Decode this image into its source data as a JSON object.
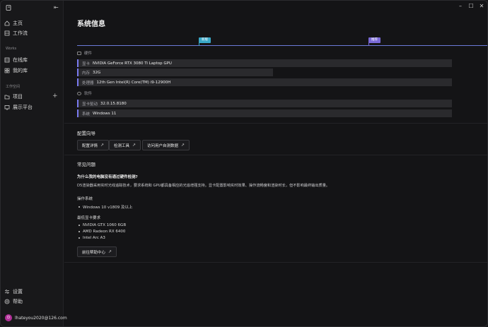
{
  "sidebar": {
    "nav": [
      {
        "label": "主页",
        "icon": "home-icon"
      },
      {
        "label": "工作流",
        "icon": "workflow-icon"
      }
    ],
    "works_label": "Works",
    "works": [
      {
        "label": "在线库",
        "icon": "library-icon"
      },
      {
        "label": "我的库",
        "icon": "my-library-icon"
      }
    ],
    "workspace_label": "工作空间",
    "workspace": [
      {
        "label": "项目",
        "icon": "project-icon"
      },
      {
        "label": "展示平台",
        "icon": "showcase-icon"
      }
    ],
    "bottom": [
      {
        "label": "设置",
        "icon": "settings-icon"
      },
      {
        "label": "帮助",
        "icon": "help-icon"
      }
    ],
    "user": {
      "initial": "D",
      "email": "lhateyou2020@126.com"
    }
  },
  "main": {
    "title": "系统信息",
    "timeline": {
      "tag_left": "新版",
      "tag_right": "推荐"
    },
    "hardware_label": "硬件",
    "hardware": [
      {
        "key": "显卡",
        "value": "NVIDIA GeForce RTX 3080 Ti Laptop GPU"
      },
      {
        "key": "内存",
        "value": "32G"
      },
      {
        "key": "处理器",
        "value": "12th Gen Intel(R) Core(TM) i9-12900H"
      }
    ],
    "software_label": "软件",
    "software": [
      {
        "key": "显卡驱动",
        "value": "32.0.15.8180"
      },
      {
        "key": "系统",
        "value": "Windows 11"
      }
    ],
    "guide_title": "配置向导",
    "guide_buttons": [
      "配置详情",
      "检测工具",
      "访问用户自测数据"
    ],
    "faq_title": "常见问题",
    "faq_question": "为什么我的电脑没有通过硬件检测?",
    "faq_answer": "D5渲染器采用实时光线追踪技术，要求系统和 GPU都具备相应的光追增强支持。显卡配置影响实时效果、操作流畅度和渲染时长，但不影响最终输出质量。",
    "os_title": "操作系统",
    "os_items": [
      "Windows 10 v1809 及以上"
    ],
    "gpu_title": "最低显卡要求",
    "gpu_items": [
      "NVIDIA GTX 1060 6GB",
      "AMD Radeon RX 6400",
      "Intel Arc A3"
    ],
    "help_button": "前往帮助中心"
  }
}
